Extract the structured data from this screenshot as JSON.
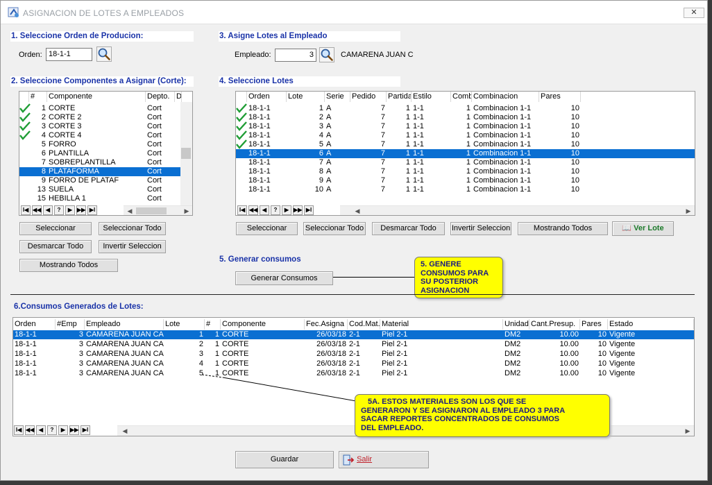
{
  "window": {
    "title": "ASIGNACION DE LOTES A EMPLEADOS",
    "close_label": "✕"
  },
  "sections": {
    "s1": "1. Seleccione Orden de Producion:",
    "s2": "2. Seleccione Componentes a Asignar (Corte):",
    "s3": "3. Asigne Lotes al Empleado",
    "s4": "4. Seleccione Lotes",
    "s5": "5. Generar consumos",
    "s6": "6.Consumos Generados de Lotes:"
  },
  "orden": {
    "label": "Orden:",
    "value": "18-1-1"
  },
  "empleado": {
    "label": "Empleado:",
    "value": "3",
    "name": "CAMARENA JUAN CA"
  },
  "componentes": {
    "headers": [
      "",
      "#",
      "Componente",
      "Depto.",
      "D"
    ],
    "rows": [
      {
        "checked": true,
        "num": "1",
        "name": "CORTE",
        "depto": "Cort"
      },
      {
        "checked": true,
        "num": "2",
        "name": "CORTE 2",
        "depto": "Cort"
      },
      {
        "checked": true,
        "num": "3",
        "name": "CORTE 3",
        "depto": "Cort"
      },
      {
        "checked": true,
        "num": "4",
        "name": "CORTE 4",
        "depto": "Cort"
      },
      {
        "checked": false,
        "num": "5",
        "name": "FORRO",
        "depto": "Cort"
      },
      {
        "checked": false,
        "num": "6",
        "name": "PLANTILLA",
        "depto": "Cort"
      },
      {
        "checked": false,
        "num": "7",
        "name": "SOBREPLANTILLA",
        "depto": "Cort"
      },
      {
        "checked": false,
        "num": "8",
        "name": "PLATAFORMA",
        "depto": "Cort",
        "selected": true
      },
      {
        "checked": false,
        "num": "9",
        "name": "FORRO DE PLATAF",
        "depto": "Cort"
      },
      {
        "checked": false,
        "num": "13",
        "name": "SUELA",
        "depto": "Cort"
      },
      {
        "checked": false,
        "num": "15",
        "name": "HEBILLA 1",
        "depto": "Cort"
      }
    ]
  },
  "lotes": {
    "headers": [
      "",
      "Orden",
      "Lote",
      "Serie",
      "Pedido",
      "Partida",
      "Estilo",
      "Comb",
      "Combinacion",
      "Pares"
    ],
    "rows": [
      {
        "checked": true,
        "orden": "18-1-1",
        "lote": "1",
        "serie": "A",
        "pedido": "7",
        "partida": "1",
        "estilo": "1-1",
        "comb": "1",
        "combinacion": "Combinacion 1-1",
        "pares": "10"
      },
      {
        "checked": true,
        "orden": "18-1-1",
        "lote": "2",
        "serie": "A",
        "pedido": "7",
        "partida": "1",
        "estilo": "1-1",
        "comb": "1",
        "combinacion": "Combinacion 1-1",
        "pares": "10"
      },
      {
        "checked": true,
        "orden": "18-1-1",
        "lote": "3",
        "serie": "A",
        "pedido": "7",
        "partida": "1",
        "estilo": "1-1",
        "comb": "1",
        "combinacion": "Combinacion 1-1",
        "pares": "10"
      },
      {
        "checked": true,
        "orden": "18-1-1",
        "lote": "4",
        "serie": "A",
        "pedido": "7",
        "partida": "1",
        "estilo": "1-1",
        "comb": "1",
        "combinacion": "Combinacion 1-1",
        "pares": "10"
      },
      {
        "checked": true,
        "orden": "18-1-1",
        "lote": "5",
        "serie": "A",
        "pedido": "7",
        "partida": "1",
        "estilo": "1-1",
        "comb": "1",
        "combinacion": "Combinacion 1-1",
        "pares": "10"
      },
      {
        "checked": false,
        "orden": "18-1-1",
        "lote": "6",
        "serie": "A",
        "pedido": "7",
        "partida": "1",
        "estilo": "1-1",
        "comb": "1",
        "combinacion": "Combinacion 1-1",
        "pares": "10",
        "selected": true
      },
      {
        "checked": false,
        "orden": "18-1-1",
        "lote": "7",
        "serie": "A",
        "pedido": "7",
        "partida": "1",
        "estilo": "1-1",
        "comb": "1",
        "combinacion": "Combinacion 1-1",
        "pares": "10"
      },
      {
        "checked": false,
        "orden": "18-1-1",
        "lote": "8",
        "serie": "A",
        "pedido": "7",
        "partida": "1",
        "estilo": "1-1",
        "comb": "1",
        "combinacion": "Combinacion 1-1",
        "pares": "10"
      },
      {
        "checked": false,
        "orden": "18-1-1",
        "lote": "9",
        "serie": "A",
        "pedido": "7",
        "partida": "1",
        "estilo": "1-1",
        "comb": "1",
        "combinacion": "Combinacion 1-1",
        "pares": "10"
      },
      {
        "checked": false,
        "orden": "18-1-1",
        "lote": "10",
        "serie": "A",
        "pedido": "7",
        "partida": "1",
        "estilo": "1-1",
        "comb": "1",
        "combinacion": "Combinacion 1-1",
        "pares": "10"
      }
    ]
  },
  "consumos": {
    "headers": [
      "Orden",
      "#Emp",
      "Empleado",
      "Lote",
      "#",
      "Componente",
      "Fec.Asigna",
      "Cod.Mat.",
      "Material",
      "Unidad",
      "Cant.Presup.",
      "Pares",
      "Estado"
    ],
    "rows": [
      {
        "orden": "18-1-1",
        "emp": "3",
        "empleado": "CAMARENA JUAN CAR",
        "lote": "1",
        "num": "1",
        "componente": "CORTE",
        "fecha": "26/03/18",
        "codmat": "2-1",
        "material": "Piel 2-1",
        "unidad": "DM2",
        "cant": "10.00",
        "pares": "10",
        "estado": "Vigente",
        "selected": true
      },
      {
        "orden": "18-1-1",
        "emp": "3",
        "empleado": "CAMARENA JUAN CAR",
        "lote": "2",
        "num": "1",
        "componente": "CORTE",
        "fecha": "26/03/18",
        "codmat": "2-1",
        "material": "Piel 2-1",
        "unidad": "DM2",
        "cant": "10.00",
        "pares": "10",
        "estado": "Vigente"
      },
      {
        "orden": "18-1-1",
        "emp": "3",
        "empleado": "CAMARENA JUAN CAR",
        "lote": "3",
        "num": "1",
        "componente": "CORTE",
        "fecha": "26/03/18",
        "codmat": "2-1",
        "material": "Piel 2-1",
        "unidad": "DM2",
        "cant": "10.00",
        "pares": "10",
        "estado": "Vigente"
      },
      {
        "orden": "18-1-1",
        "emp": "3",
        "empleado": "CAMARENA JUAN CAR",
        "lote": "4",
        "num": "1",
        "componente": "CORTE",
        "fecha": "26/03/18",
        "codmat": "2-1",
        "material": "Piel 2-1",
        "unidad": "DM2",
        "cant": "10.00",
        "pares": "10",
        "estado": "Vigente"
      },
      {
        "orden": "18-1-1",
        "emp": "3",
        "empleado": "CAMARENA JUAN CAR",
        "lote": "5",
        "num": "1",
        "componente": "CORTE",
        "fecha": "26/03/18",
        "codmat": "2-1",
        "material": "Piel 2-1",
        "unidad": "DM2",
        "cant": "10.00",
        "pares": "10",
        "estado": "Vigente"
      }
    ]
  },
  "buttons": {
    "seleccionar": "Seleccionar",
    "seleccionar_todo": "Seleccionar Todo",
    "desmarcar_todo": "Desmarcar Todo",
    "invertir_seleccion": "Invertir Seleccion",
    "mostrando_todos": "Mostrando Todos",
    "ver_lote": "Ver Lote",
    "generar_consumos": "Generar Consumos",
    "guardar": "Guardar",
    "salir": "Salir"
  },
  "nav_symbols": [
    "I◀",
    "◀◀",
    "◀",
    "?",
    "▶",
    "▶▶",
    "▶I"
  ],
  "callouts": {
    "c5": [
      "5. GENERE",
      "CONSUMOS PARA",
      "SU POSTERIOR",
      "ASIGNACION"
    ],
    "c5a": [
      "5A.  ESTOS MATERIALES SON LOS QUE SE",
      "GENERARON Y SE ASIGNARON AL EMPLEADO 3 PARA",
      "SACAR REPORTES CONCENTRADOS DE CONSUMOS",
      "DEL EMPLEADO."
    ]
  },
  "colors": {
    "section_title": "#1a33a8",
    "selection": "#0a6fd2",
    "check": "#1f9d35",
    "callout": "#ffff00"
  }
}
